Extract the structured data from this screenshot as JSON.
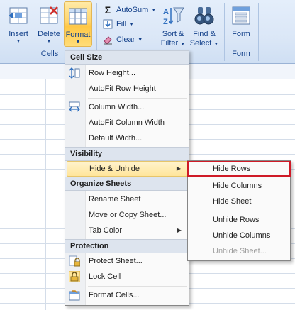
{
  "ribbon": {
    "insert_label": "Insert",
    "delete_label": "Delete",
    "format_label": "Format",
    "cells_group": "Cells",
    "autosum_label": "AutoSum",
    "fill_label": "Fill",
    "clear_label": "Clear",
    "sort_filter_label_1": "Sort &",
    "sort_filter_label_2": "Filter",
    "find_select_label_1": "Find &",
    "find_select_label_2": "Select",
    "form_label": "Form",
    "form_group": "Form",
    "accent_color": "#ffd46b"
  },
  "menu": {
    "sections": {
      "cell_size": "Cell Size",
      "visibility": "Visibility",
      "organize_sheets": "Organize Sheets",
      "protection": "Protection"
    },
    "items": {
      "row_height": "Row Height...",
      "autofit_row_height": "AutoFit Row Height",
      "column_width": "Column Width...",
      "autofit_column_width": "AutoFit Column Width",
      "default_width": "Default Width...",
      "hide_unhide": "Hide & Unhide",
      "rename_sheet": "Rename Sheet",
      "move_copy_sheet": "Move or Copy Sheet...",
      "tab_color": "Tab Color",
      "protect_sheet": "Protect Sheet...",
      "lock_cell": "Lock Cell",
      "format_cells": "Format Cells..."
    }
  },
  "submenu": {
    "hide_rows": "Hide Rows",
    "hide_columns": "Hide Columns",
    "hide_sheet": "Hide Sheet",
    "unhide_rows": "Unhide Rows",
    "unhide_columns": "Unhide Columns",
    "unhide_sheet": "Unhide Sheet..."
  }
}
